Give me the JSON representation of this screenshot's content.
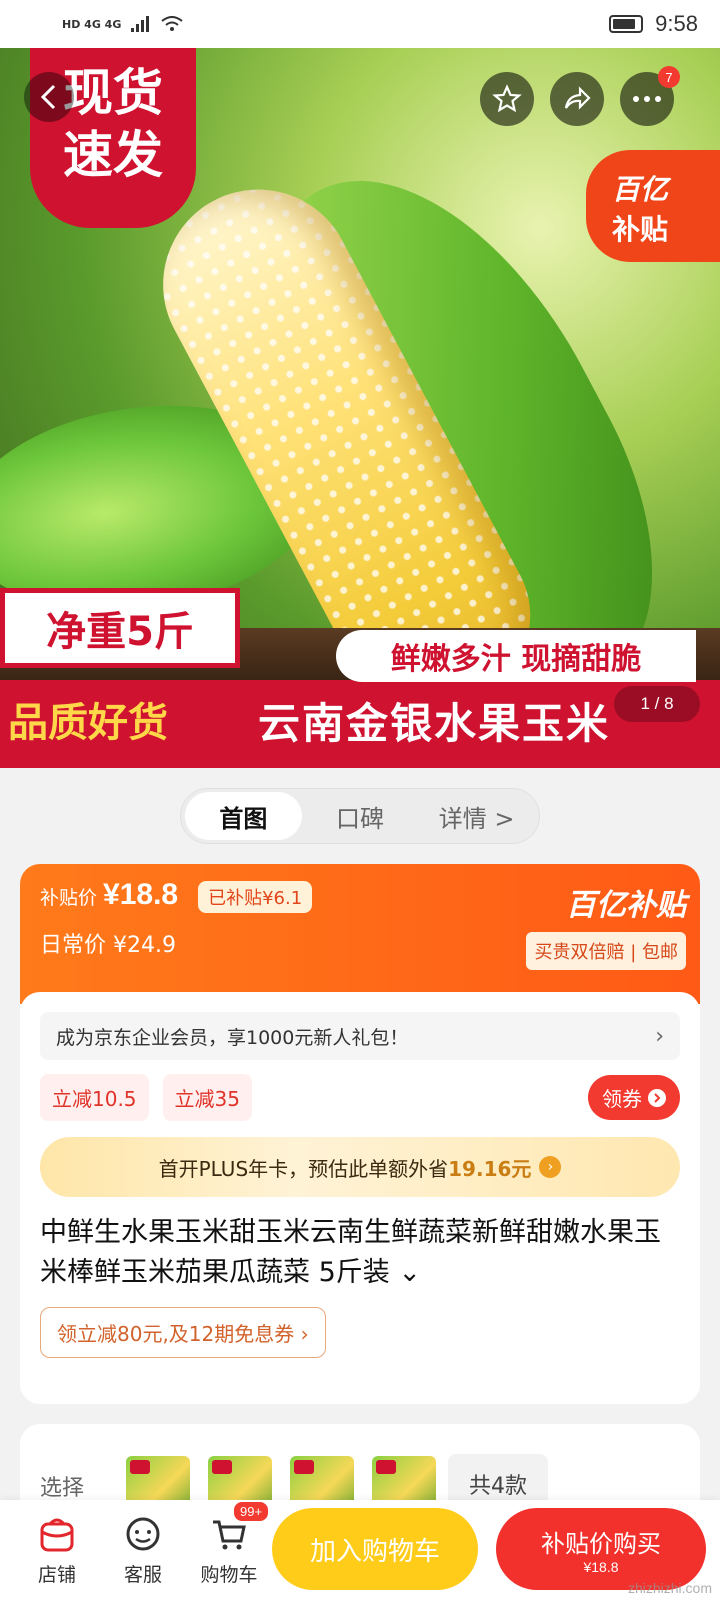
{
  "status_bar": {
    "network_left": "HD 4G 4G",
    "time": "9:58"
  },
  "hero": {
    "tag_fast_line1": "现货",
    "tag_fast_line2": "速发",
    "subsidy_corner_line1": "百亿",
    "subsidy_corner_line2": "补贴",
    "net_weight": "净重5斤",
    "tagline": "鲜嫩多汁 现摘甜脆",
    "quality": "品质好货",
    "product_big": "云南金银水果玉米",
    "image_counter": "1 / 8",
    "menu_badge": "7"
  },
  "tabs": [
    {
      "label": "首图"
    },
    {
      "label": "口碑"
    },
    {
      "label": "详情 >"
    }
  ],
  "price": {
    "subsidy_label": "补贴价",
    "subsidy_price": "¥18.8",
    "subsidized_pill": "已补贴¥6.1",
    "regular_label": "日常价",
    "regular_price": "¥24.9",
    "brand": "百亿补贴",
    "promise": "买贵双倍赔 | 包邮"
  },
  "promo": {
    "member_text": "成为京东企业会员，享1000元新人礼包！",
    "member_arrow": "›",
    "coupons": [
      "立减10.5",
      "立减35"
    ],
    "coupon_button": "领券",
    "plus_text_prefix": "首开PLUS年卡，预估此单额外省",
    "plus_amount": "19.16元",
    "product_title": "中鲜生水果玉米甜玉米云南生鲜蔬菜新鲜甜嫩水果玉米棒鲜玉米茄果瓜蔬菜 5斤装 ⌄",
    "coupon_link": "领立减80元,及12期免息券 ›"
  },
  "options": {
    "label": "选择",
    "total": "共4款",
    "thumb_count": 4
  },
  "bottom_bar": {
    "store": "店铺",
    "service": "客服",
    "cart": "购物车",
    "cart_badge": "99+",
    "add_to_cart": "加入购物车",
    "buy_line1": "补贴价购买",
    "buy_line2": "¥18.8"
  },
  "watermark": "zhizhizhi.com",
  "colors": {
    "brand_red": "#cf1230",
    "subsidy_orange": "#ff5a16",
    "cart_yellow": "#ffcc1a",
    "buy_red": "#f2302c"
  }
}
